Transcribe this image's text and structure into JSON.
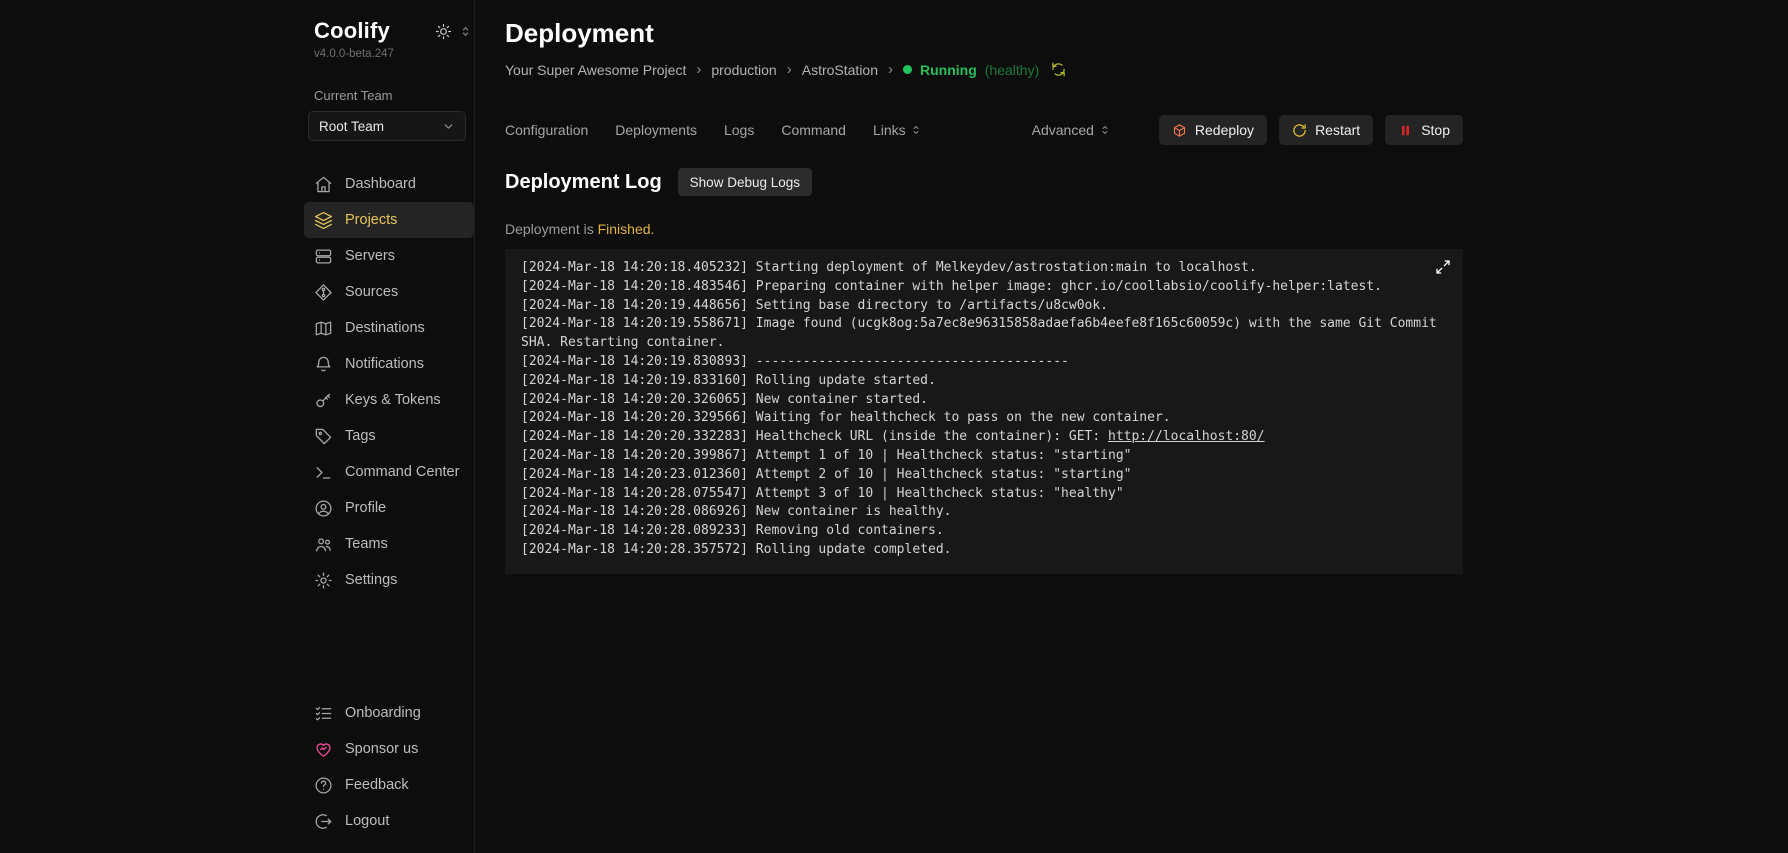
{
  "app": {
    "name": "Coolify",
    "version": "v4.0.0-beta.247"
  },
  "sidebar": {
    "team_label": "Current Team",
    "team_selected": "Root Team",
    "items": [
      "Dashboard",
      "Projects",
      "Servers",
      "Sources",
      "Destinations",
      "Notifications",
      "Keys & Tokens",
      "Tags",
      "Command Center",
      "Profile",
      "Teams",
      "Settings"
    ],
    "active_item": "Projects",
    "footer_items": [
      "Onboarding",
      "Sponsor us",
      "Feedback",
      "Logout"
    ]
  },
  "header": {
    "title": "Deployment",
    "breadcrumb": [
      "Your Super Awesome Project",
      "production",
      "AstroStation"
    ],
    "separator": "›",
    "status": {
      "state": "Running",
      "health": "(healthy)"
    }
  },
  "tabs": [
    "Configuration",
    "Deployments",
    "Logs",
    "Command",
    "Links"
  ],
  "toolbar": {
    "advanced_label": "Advanced",
    "redeploy_label": "Redeploy",
    "restart_label": "Restart",
    "stop_label": "Stop"
  },
  "deployment": {
    "section_title": "Deployment Log",
    "debug_button": "Show Debug Logs",
    "status_prefix": "Deployment is ",
    "status_value": "Finished.",
    "log_lines": [
      "[2024-Mar-18 14:20:18.405232] Starting deployment of Melkeydev/astrostation:main to localhost.",
      "[2024-Mar-18 14:20:18.483546] Preparing container with helper image: ghcr.io/coollabsio/coolify-helper:latest.",
      "[2024-Mar-18 14:20:19.448656] Setting base directory to /artifacts/u8cw0ok.",
      "[2024-Mar-18 14:20:19.558671] Image found (ucgk8og:5a7ec8e96315858adaefa6b4eefe8f165c60059c) with the same Git Commit SHA. Restarting container.",
      "[2024-Mar-18 14:20:19.830893] ----------------------------------------",
      "[2024-Mar-18 14:20:19.833160] Rolling update started.",
      "[2024-Mar-18 14:20:20.326065] New container started.",
      "[2024-Mar-18 14:20:20.329566] Waiting for healthcheck to pass on the new container.",
      {
        "prefix": "[2024-Mar-18 14:20:20.332283] Healthcheck URL (inside the container): GET: ",
        "link": "http://localhost:80/"
      },
      "[2024-Mar-18 14:20:20.399867] Attempt 1 of 10 | Healthcheck status: \"starting\"",
      "[2024-Mar-18 14:20:23.012360] Attempt 2 of 10 | Healthcheck status: \"starting\"",
      "[2024-Mar-18 14:20:28.075547] Attempt 3 of 10 | Healthcheck status: \"healthy\"",
      "[2024-Mar-18 14:20:28.086926] New container is healthy.",
      "[2024-Mar-18 14:20:28.089233] Removing old containers.",
      "[2024-Mar-18 14:20:28.357572] Rolling update completed."
    ]
  },
  "colors": {
    "accent_gold": "#e6c458",
    "finished_gold": "#dfb33c",
    "status_green": "#22c55e",
    "redeploy_orange": "#f97850",
    "restart_yellow": "#e3c233",
    "stop_red": "#dc2626",
    "sponsor_pink": "#ec4899",
    "background": "#0d0d0d",
    "log_background": "#181818"
  }
}
